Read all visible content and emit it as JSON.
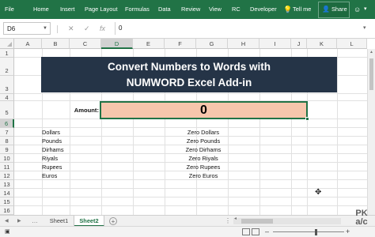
{
  "ribbon": {
    "tabs": [
      "File",
      "Home",
      "Insert",
      "Page Layout",
      "Formulas",
      "Data",
      "Review",
      "View",
      "RC",
      "Developer"
    ],
    "tell_me": "Tell me",
    "share": "Share",
    "bg_color": "#217346"
  },
  "formula_bar": {
    "name_box": "D6",
    "cancel_symbol": "✕",
    "enter_symbol": "✓",
    "fx_symbol": "fx",
    "content": "0"
  },
  "grid": {
    "columns": [
      "A",
      "B",
      "C",
      "D",
      "E",
      "F",
      "G",
      "H",
      "I",
      "J",
      "K",
      "L"
    ],
    "rows": [
      "1",
      "2",
      "3",
      "4",
      "5",
      "6",
      "7",
      "8",
      "9",
      "10",
      "11",
      "12",
      "13",
      "14",
      "15",
      "16"
    ],
    "selected_column": "D",
    "selected_row": "6"
  },
  "content": {
    "title_line1": "Convert Numbers to Words with",
    "title_line2": "NUMWORD Excel Add-in",
    "amount_label": "Amount:",
    "amount_value": "0",
    "currencies": [
      "Dollars",
      "Pounds",
      "Dirhams",
      "Riyals",
      "Rupees",
      "Euros"
    ],
    "words": [
      "Zero Dollars",
      "Zero Pounds",
      "Zero Dirhams",
      "Zero Riyals",
      "Zero Rupees",
      "Zero Euros"
    ],
    "title_bg": "#253447",
    "amount_bg": "#f6c6ac"
  },
  "sheets": {
    "tabs": [
      "Sheet1",
      "Sheet2"
    ],
    "active": "Sheet2",
    "add_symbol": "+"
  },
  "watermark": {
    "line1": "PK",
    "line2": "a/c"
  }
}
